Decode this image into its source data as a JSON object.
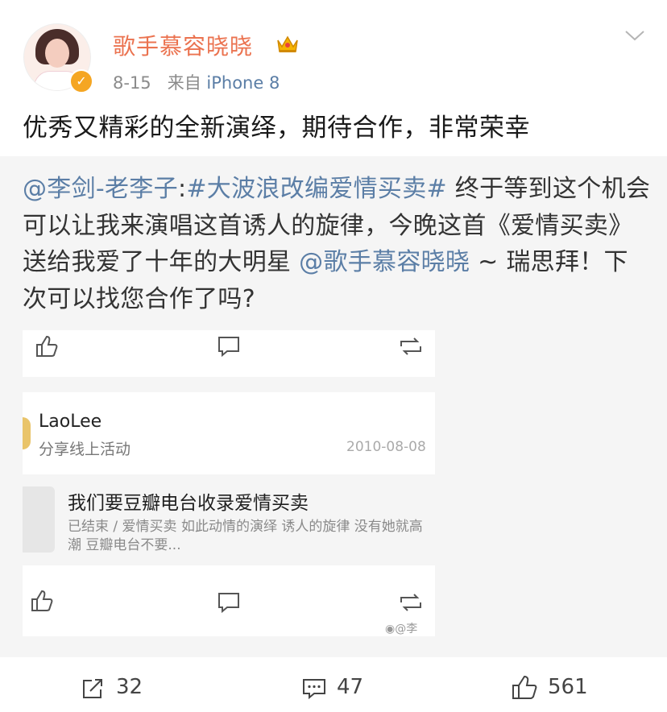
{
  "header": {
    "username": "歌手慕容晓晓",
    "time": "8-15",
    "source_prefix": "来自",
    "source_device": "iPhone 8"
  },
  "post": {
    "text": "优秀又精彩的全新演绎，期待合作，非常荣幸"
  },
  "repost": {
    "mention_author": "@李剑-老李子",
    "colon": ":",
    "hashtag": "#大波浪改编爱情买卖#",
    "body_1": " 终于等到这个机会可以让我来演唱这首诱人的旋律，今晚这首《爱情买卖》送给我爱了十年的大明星 ",
    "mention_singer": "@歌手慕容晓晓",
    "body_2": " ~ 瑞思拜！下次可以找您合作了吗?"
  },
  "screenshot": {
    "author": "LaoLee",
    "subtitle": "分享线上活动",
    "date": "2010-08-08",
    "event_title": "我们要豆瓣电台收录爱情买卖",
    "event_desc": "已结束 / 爱情买卖 如此动情的演绎 诱人的旋律 没有她就高潮 豆瓣电台不要...",
    "watermark": "@李"
  },
  "actions": {
    "share_count": "32",
    "comment_count": "47",
    "like_count": "561"
  },
  "colors": {
    "username": "#eb7350",
    "link": "#5b7ea6",
    "verified": "#f5a623"
  }
}
